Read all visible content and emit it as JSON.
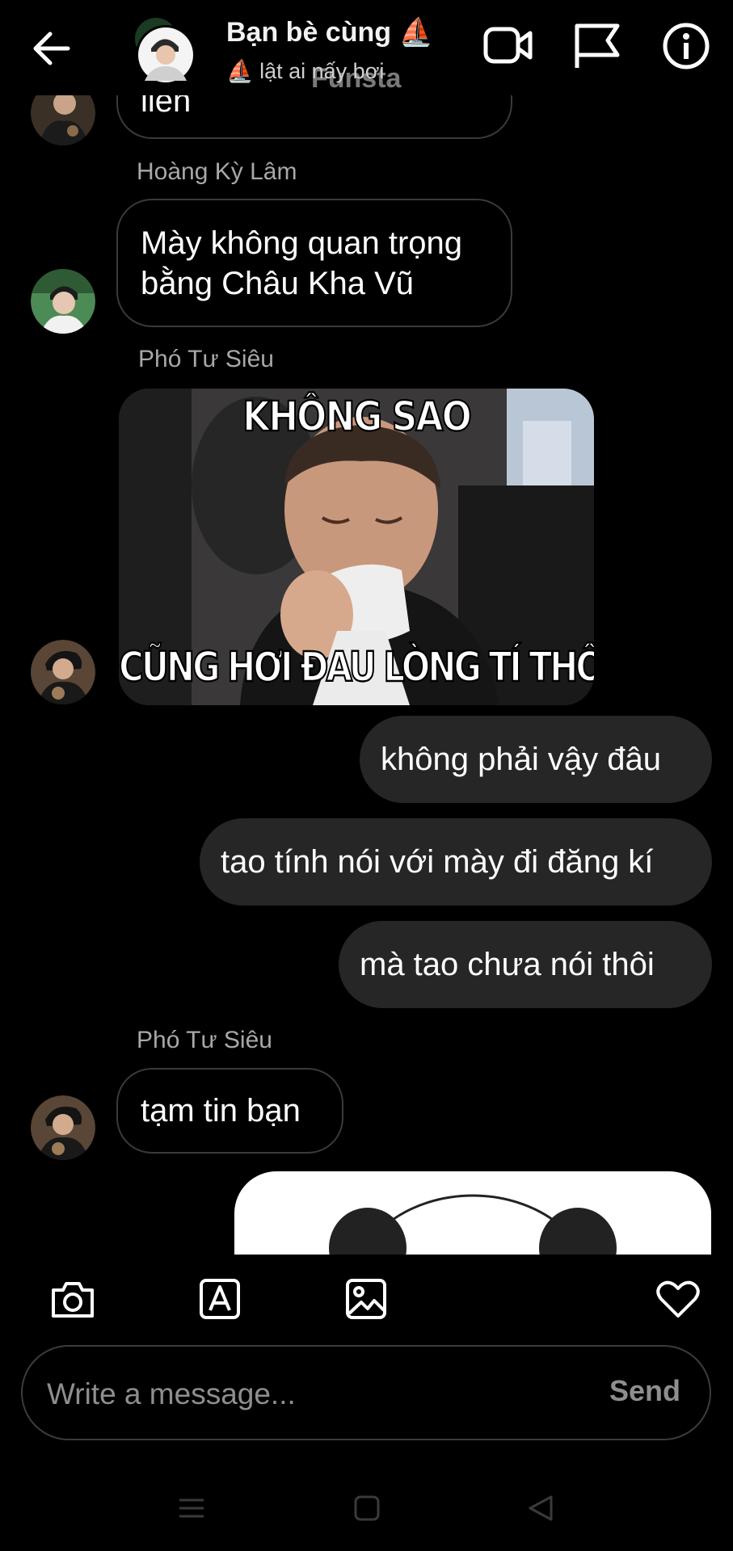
{
  "header": {
    "title": "Bạn bè cùng ⛵",
    "subtitle": "⛵ lật ai nấy bơi",
    "ghost_text": "Funsta",
    "icons": [
      "back-arrow-icon",
      "video-call-icon",
      "flag-icon",
      "info-icon"
    ]
  },
  "messages": {
    "partial_top_text": "liền",
    "sender_1": "Hoàng Kỳ Lâm",
    "msg_1_line1": "Mày không quan trọng",
    "msg_1_line2": "bằng Châu Kha Vũ",
    "sender_2": "Phó Tư Siêu",
    "meme_top": "KHÔNG SAO",
    "meme_bottom": "CŨNG HƠI ĐAU LÒNG TÍ THÔI",
    "out_1": "không phải vậy đâu",
    "out_2": "tao tính nói với mày đi đăng kí",
    "out_3": "mà tao chưa nói thôi",
    "sender_3": "Phó Tư Siêu",
    "msg_2": "tạm tin bạn"
  },
  "composer": {
    "placeholder": "Write a message...",
    "send_label": "Send",
    "tools": [
      "camera-icon",
      "text-sticker-icon",
      "gallery-icon",
      "heart-icon"
    ]
  },
  "colors": {
    "background": "#000000",
    "outgoing_bubble": "#262626",
    "incoming_border": "#3a3a3a",
    "secondary_text": "#a8a8a8"
  }
}
